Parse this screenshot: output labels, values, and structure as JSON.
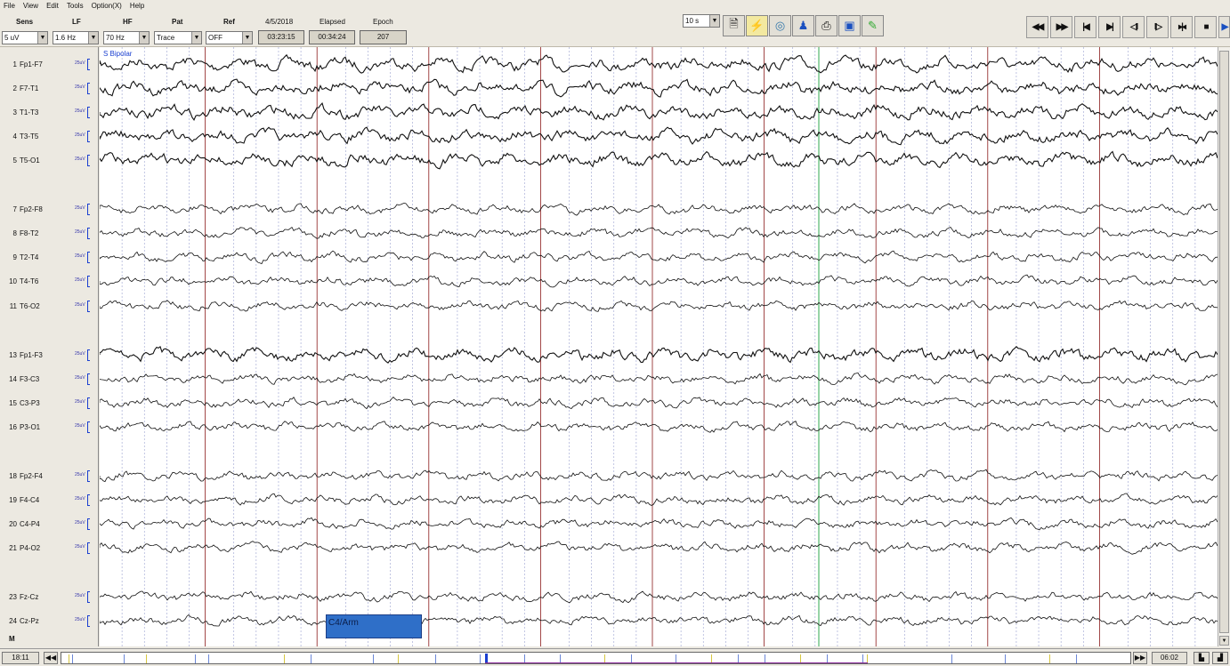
{
  "menu": [
    "File",
    "View",
    "Edit",
    "Tools",
    "Option(X)",
    "Help"
  ],
  "toolbar": {
    "sens": {
      "label": "Sens",
      "value": "5 uV"
    },
    "lf": {
      "label": "LF",
      "value": "1.6 Hz"
    },
    "hf": {
      "label": "HF",
      "value": "70 Hz"
    },
    "pat": {
      "label": "Pat",
      "value": "Trace"
    },
    "ref": {
      "label": "Ref",
      "value": "OFF"
    },
    "date": {
      "label": "4/5/2018",
      "value": "03:23:15"
    },
    "elapsed": {
      "label": "Elapsed",
      "value": "00:34:24"
    },
    "epoch": {
      "label": "Epoch",
      "value": "207"
    },
    "timebase": "10 s",
    "tool_icons": [
      "save-icon",
      "montage-on-icon",
      "globe-icon",
      "patient-icon",
      "print-icon",
      "photo-icon",
      "export-icon"
    ],
    "nav_labels": [
      "◀◀",
      "▶▶",
      "|◀",
      "▶|",
      "◁II",
      "II▷",
      "▸|◂",
      "■",
      "▶"
    ]
  },
  "montage_label": "S  Bipolar",
  "channels": [
    {
      "num": "1",
      "name": "Fp1-F7",
      "scale": "25uV"
    },
    {
      "num": "2",
      "name": "F7-T1",
      "scale": "25uV"
    },
    {
      "num": "3",
      "name": "T1-T3",
      "scale": "25uV"
    },
    {
      "num": "4",
      "name": "T3-T5",
      "scale": "25uV"
    },
    {
      "num": "5",
      "name": "T5-O1",
      "scale": "25uV"
    },
    {
      "num": "7",
      "name": "Fp2-F8",
      "scale": "25uV"
    },
    {
      "num": "8",
      "name": "F8-T2",
      "scale": "25uV"
    },
    {
      "num": "9",
      "name": "T2-T4",
      "scale": "25uV"
    },
    {
      "num": "10",
      "name": "T4-T6",
      "scale": "25uV"
    },
    {
      "num": "11",
      "name": "T6-O2",
      "scale": "25uV"
    },
    {
      "num": "13",
      "name": "Fp1-F3",
      "scale": "25uV"
    },
    {
      "num": "14",
      "name": "F3-C3",
      "scale": "25uV"
    },
    {
      "num": "15",
      "name": "C3-P3",
      "scale": "25uV"
    },
    {
      "num": "16",
      "name": "P3-O1",
      "scale": "25uV"
    },
    {
      "num": "18",
      "name": "Fp2-F4",
      "scale": "25uV"
    },
    {
      "num": "19",
      "name": "F4-C4",
      "scale": "25uV"
    },
    {
      "num": "20",
      "name": "C4-P4",
      "scale": "25uV"
    },
    {
      "num": "21",
      "name": "P4-O2",
      "scale": "25uV"
    },
    {
      "num": "23",
      "name": "Fz-Cz",
      "scale": "25uV"
    },
    {
      "num": "24",
      "name": "Cz-Pz",
      "scale": "25uV"
    }
  ],
  "marker_row": "M",
  "annotation": "C4/Arm",
  "bottom": {
    "start_time": "18:11",
    "end_time": "06:02"
  },
  "colors": {
    "trace": "#111111",
    "second_line": "#8b1a1a",
    "sub_grid": "#9aa0d0",
    "cursor": "#2fa84f",
    "annotation": "#2f6fc8"
  }
}
